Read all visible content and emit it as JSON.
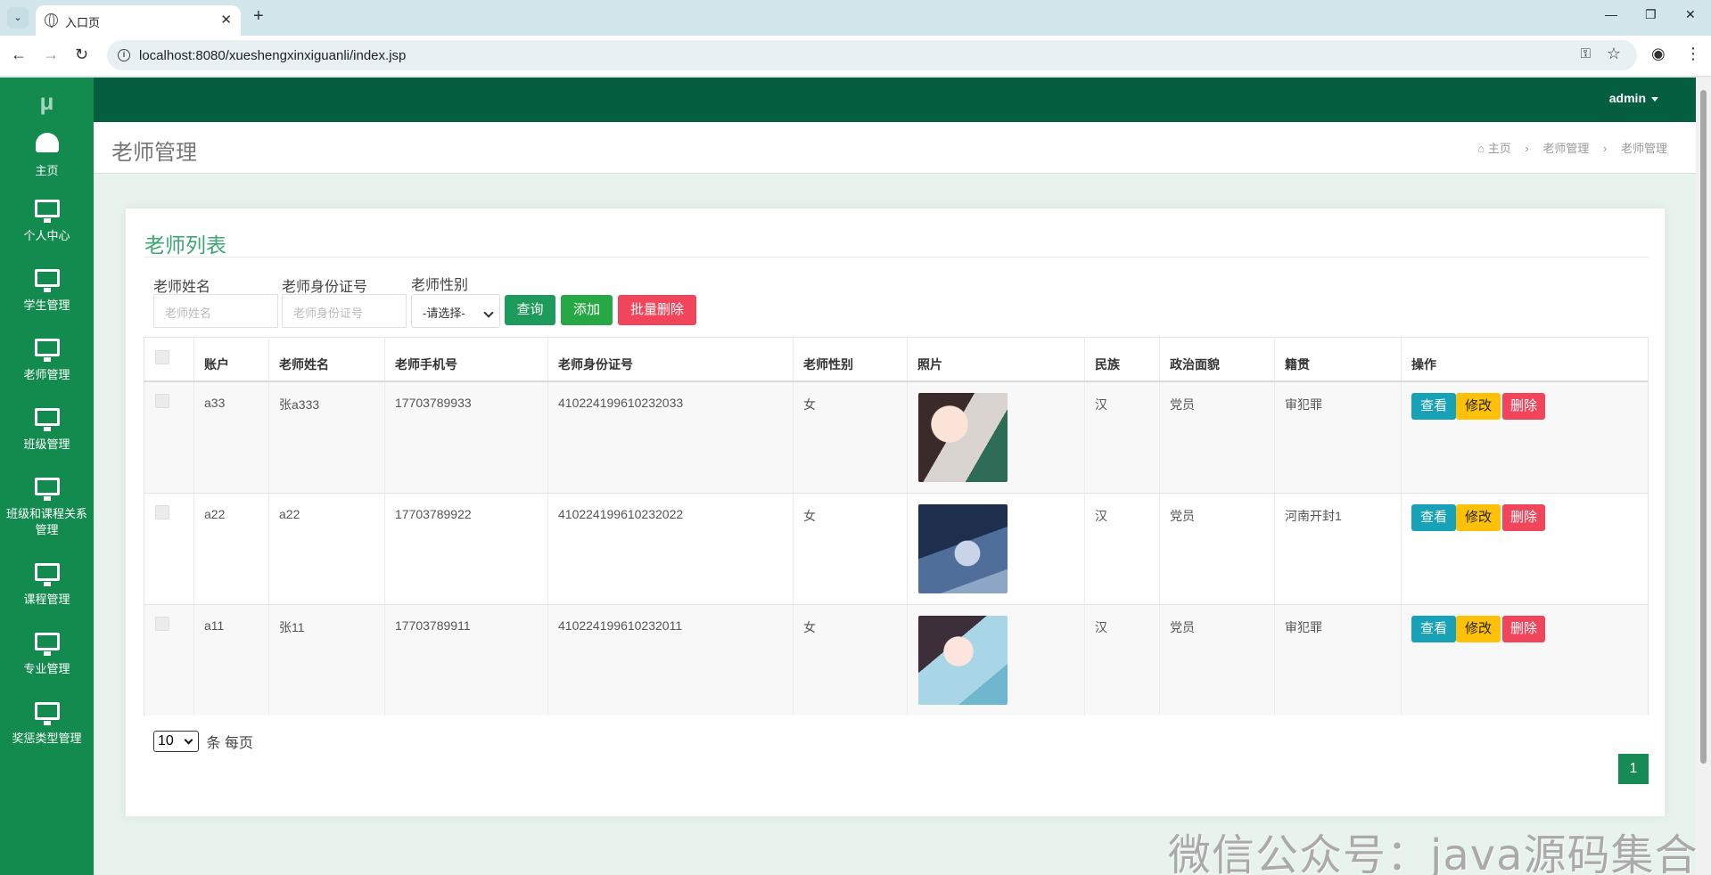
{
  "browser": {
    "tab_title": "入口页",
    "url": "localhost:8080/xueshengxinxiguanli/index.jsp"
  },
  "app": {
    "logo": "μ",
    "user": "admin",
    "sidebar": [
      {
        "label": "主页",
        "icon": "dashboard-icon"
      },
      {
        "label": "个人中心",
        "icon": "monitor-icon"
      },
      {
        "label": "学生管理",
        "icon": "monitor-icon"
      },
      {
        "label": "老师管理",
        "icon": "monitor-icon"
      },
      {
        "label": "班级管理",
        "icon": "monitor-icon"
      },
      {
        "label": "班级和课程关系管理",
        "icon": "monitor-icon"
      },
      {
        "label": "课程管理",
        "icon": "monitor-icon"
      },
      {
        "label": "专业管理",
        "icon": "monitor-icon"
      },
      {
        "label": "奖惩类型管理",
        "icon": "monitor-icon"
      }
    ]
  },
  "page": {
    "title": "老师管理",
    "breadcrumb": [
      "主页",
      "老师管理",
      "老师管理"
    ]
  },
  "panel": {
    "title": "老师列表",
    "filters": {
      "name_label": "老师姓名",
      "name_placeholder": "老师姓名",
      "id_label": "老师身份证号",
      "id_placeholder": "老师身份证号",
      "gender_label": "老师性别",
      "gender_value": "-请选择-"
    },
    "buttons": {
      "search": "查询",
      "add": "添加",
      "batch_delete": "批量删除"
    },
    "columns": [
      "账户",
      "老师姓名",
      "老师手机号",
      "老师身份证号",
      "老师性别",
      "照片",
      "民族",
      "政治面貌",
      "籍贯",
      "操作"
    ],
    "rows": [
      {
        "account": "a33",
        "name": "张a333",
        "phone": "17703789933",
        "id_no": "410224199610232033",
        "gender": "女",
        "ethnic": "汉",
        "politics": "党员",
        "origin": "审犯罪"
      },
      {
        "account": "a22",
        "name": "a22",
        "phone": "17703789922",
        "id_no": "410224199610232022",
        "gender": "女",
        "ethnic": "汉",
        "politics": "党员",
        "origin": "河南开封1"
      },
      {
        "account": "a11",
        "name": "张11",
        "phone": "17703789911",
        "id_no": "410224199610232011",
        "gender": "女",
        "ethnic": "汉",
        "politics": "党员",
        "origin": "审犯罪"
      }
    ],
    "actions": {
      "view": "查看",
      "edit": "修改",
      "delete": "删除"
    },
    "page_size": "10",
    "page_size_suffix": "条 每页",
    "current_page": "1"
  },
  "watermark": "微信公众号：java源码集合",
  "colors": {
    "sidebar": "#138a4e",
    "topbar": "#045e3f",
    "accent": "#3aa870",
    "btn_view": "#17a2b8",
    "btn_edit": "#ffc107",
    "btn_delete": "#f0455a",
    "btn_search": "#1e9a5c",
    "btn_add": "#28a745",
    "btn_batch": "#f0455a"
  }
}
